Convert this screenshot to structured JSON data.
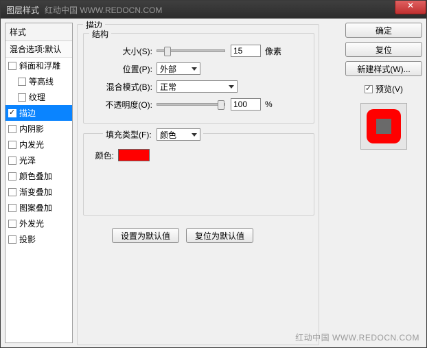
{
  "window": {
    "title": "图层样式",
    "watermark": "红动中国 WWW.REDOCN.COM",
    "close_glyph": "✕"
  },
  "sidebar": {
    "header": "样式",
    "sub": "混合选项:默认",
    "items": [
      {
        "label": "斜面和浮雕",
        "checked": false,
        "indent": false
      },
      {
        "label": "等高线",
        "checked": false,
        "indent": true
      },
      {
        "label": "纹理",
        "checked": false,
        "indent": true
      },
      {
        "label": "描边",
        "checked": true,
        "indent": false,
        "selected": true
      },
      {
        "label": "内阴影",
        "checked": false,
        "indent": false
      },
      {
        "label": "内发光",
        "checked": false,
        "indent": false
      },
      {
        "label": "光泽",
        "checked": false,
        "indent": false
      },
      {
        "label": "颜色叠加",
        "checked": false,
        "indent": false
      },
      {
        "label": "渐变叠加",
        "checked": false,
        "indent": false
      },
      {
        "label": "图案叠加",
        "checked": false,
        "indent": false
      },
      {
        "label": "外发光",
        "checked": false,
        "indent": false
      },
      {
        "label": "投影",
        "checked": false,
        "indent": false
      }
    ]
  },
  "main": {
    "outer_title": "描边",
    "struct_title": "结构",
    "size_label": "大小(S):",
    "size_value": "15",
    "size_unit": "像素",
    "pos_label": "位置(P):",
    "pos_value": "外部",
    "blend_label": "混合模式(B):",
    "blend_value": "正常",
    "opacity_label": "不透明度(O):",
    "opacity_value": "100",
    "opacity_unit": "%",
    "fill_label": "填充类型(F):",
    "fill_value": "颜色",
    "color_label": "颜色:",
    "color_hex": "#ff0000",
    "btn_default": "设置为默认值",
    "btn_reset": "复位为默认值"
  },
  "right": {
    "ok": "确定",
    "cancel": "复位",
    "newstyle": "新建样式(W)...",
    "preview": "预览(V)"
  },
  "footer_watermark": "红动中国 WWW.REDOCN.COM"
}
